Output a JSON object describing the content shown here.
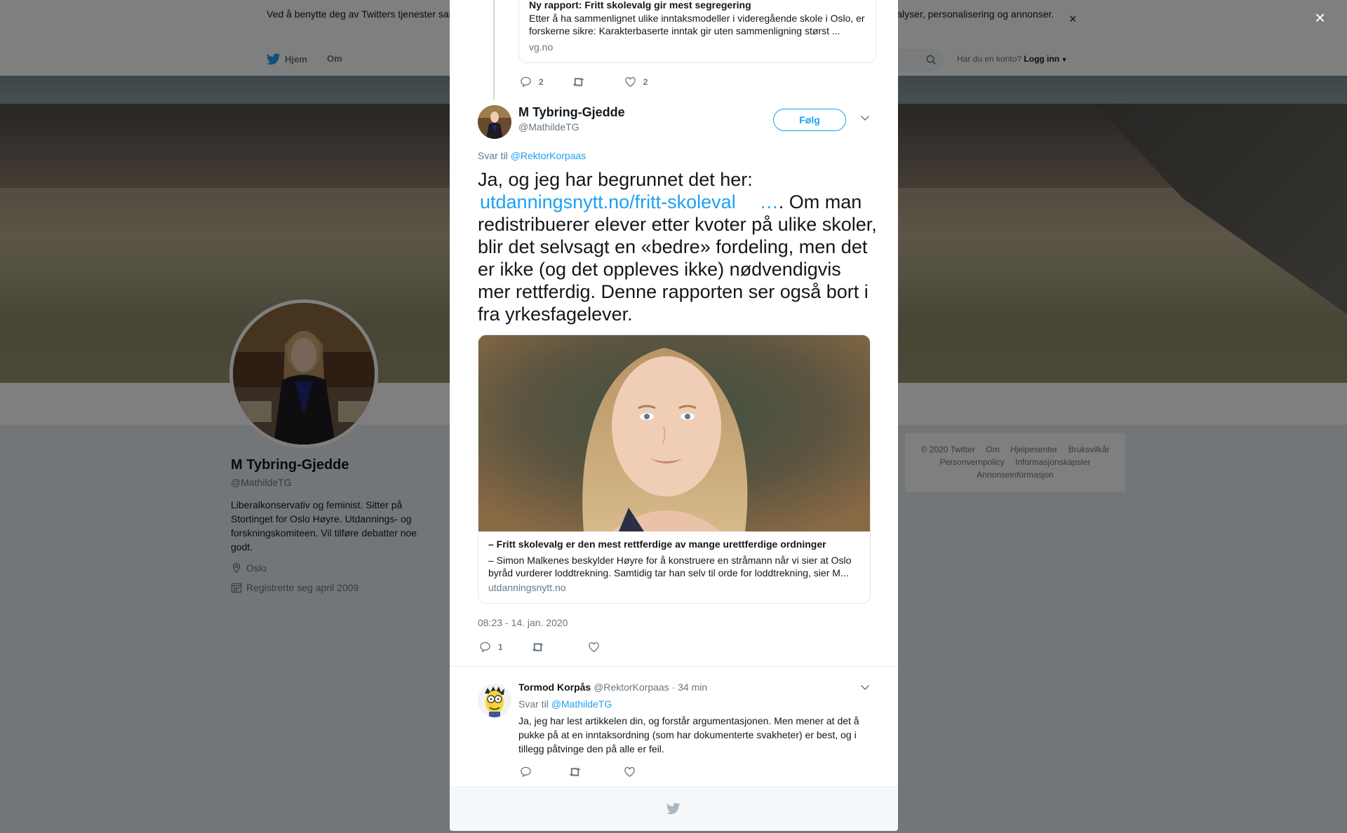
{
  "cookie": {
    "text": "Ved å benytte deg av Twitters tjenester samtykker du i vår bruk av informasjonskapsler. Vi og våre partnere bruker informasjonskapsler til bl.a. analyser, personalisering og annonser.",
    "close": "×"
  },
  "nav": {
    "home": "Hjem",
    "about": "Om",
    "account_q": "Har du en konto?",
    "login": "Logg inn"
  },
  "profile": {
    "name": "M Tybring-Gjedde",
    "handle": "@MathildeTG",
    "bio": "Liberalkonservativ og feminist. Sitter på Stortinget for Oslo Høyre. Utdannings- og forskningskomiteen. Vil tilføre debatter noe godt.",
    "location": "Oslo",
    "joined": "Registrerte seg april 2009"
  },
  "footer": {
    "row1": [
      "© 2020 Twitter",
      "Om",
      "Hjelpesenter",
      "Bruksvilkår"
    ],
    "row2": [
      "Personvernpolicy",
      "Informasjonskapsler"
    ],
    "row3": [
      "Annonseinformasjon"
    ]
  },
  "modal": {
    "close": "×",
    "prev_card": {
      "title": "Ny rapport: Fritt skolevalg gir mest segregering",
      "desc": "Etter å ha sammenlignet ulike inntaksmodeller i videregående skole i Oslo, er forskerne sikre: Karakterbaserte inntak gir uten sammenligning størst ...",
      "site": "vg.no"
    },
    "prev_actions": {
      "replies": "2",
      "likes": "2"
    },
    "main_tweet": {
      "name": "M Tybring-Gjedde",
      "handle": "@MathildeTG",
      "follow": "Følg",
      "reply_prefix": "Svar til",
      "reply_to": "@RektorKorpaas",
      "text_1": "Ja, og jeg har begrunnet det her: ",
      "link": "utdanningsnytt.no/fritt-skoleval",
      "ellipsis": "…",
      "text_2": ". Om man redistribuerer elever etter kvoter på ulike skoler, blir det selvsagt en «bedre» fordeling, men det er ikke (og det oppleves ikke) nødvendigvis mer rettferdig. Denne rapporten ser også bort i fra yrkesfagelever.",
      "card_title": "– Fritt skolevalg er den mest rettferdige av mange urettferdige ordninger",
      "card_desc": "– Simon Malkenes beskylder Høyre for å konstruere en stråmann når vi sier at Oslo byråd vurderer loddtrekning. Samtidig tar han selv til orde for loddtrekning, sier M...",
      "card_site": "utdanningsnytt.no",
      "timestamp": "08:23 - 14. jan. 2020",
      "replies": "1"
    },
    "reply": {
      "name": "Tormod Korpås",
      "handle": "@RektorKorpaas",
      "time": "· 34 min",
      "reply_prefix": "Svar til",
      "reply_to": "@MathildeTG",
      "text": "Ja, jeg har lest artikkelen din, og forstår argumentasjonen.  Men mener at det å pukke på at en inntaksordning (som har dokumenterte svakheter) er best, og i tillegg påtvinge den på alle er feil."
    }
  },
  "colors": {
    "accent": "#1da1f2",
    "muted": "#657786",
    "text": "#14171a"
  },
  "icons": [
    "twitter-bird-icon",
    "search-icon",
    "location-icon",
    "calendar-icon",
    "reply-icon",
    "retweet-icon",
    "like-icon",
    "chevron-down-icon",
    "close-icon"
  ]
}
